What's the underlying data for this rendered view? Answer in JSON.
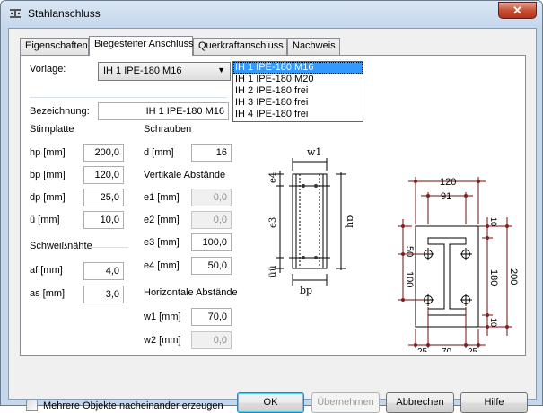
{
  "window": {
    "title": "Stahlanschluss",
    "close_label": "✕"
  },
  "tabs": [
    {
      "label": "Eigenschaften"
    },
    {
      "label": "Biegesteifer Anschluss"
    },
    {
      "label": "Querkraftanschluss"
    },
    {
      "label": "Nachweis"
    }
  ],
  "vorlage": {
    "label": "Vorlage:",
    "value": "IH 1 IPE-180 M16",
    "options": [
      "IH 1 IPE-180 M16",
      "IH 1 IPE-180 M20",
      "IH 2 IPE-180 frei",
      "IH 3 IPE-180 frei",
      "IH 4 IPE-180 frei"
    ]
  },
  "bezeichnung": {
    "label": "Bezeichnung:",
    "value": "IH 1 IPE-180 M16"
  },
  "stirnplatte": {
    "title": "Stirnplatte",
    "hp": {
      "label": "hp [mm]",
      "value": "200,0"
    },
    "bp": {
      "label": "bp [mm]",
      "value": "120,0"
    },
    "dp": {
      "label": "dp [mm]",
      "value": "25,0"
    },
    "u": {
      "label": "ü [mm]",
      "value": "10,0"
    }
  },
  "schweissnaehte": {
    "title": "Schweißnähte",
    "af": {
      "label": "af [mm]",
      "value": "4,0"
    },
    "as": {
      "label": "as [mm]",
      "value": "3,0"
    }
  },
  "schrauben": {
    "title": "Schrauben",
    "d": {
      "label": "d [mm]",
      "value": "16"
    }
  },
  "vertikale": {
    "title": "Vertikale Abstände",
    "e1": {
      "label": "e1 [mm]",
      "value": "0,0"
    },
    "e2": {
      "label": "e2 [mm]",
      "value": "0,0"
    },
    "e3": {
      "label": "e3 [mm]",
      "value": "100,0"
    },
    "e4": {
      "label": "e4 [mm]",
      "value": "50,0"
    }
  },
  "horizontale": {
    "title": "Horizontale Abstände",
    "w1": {
      "label": "w1 [mm]",
      "value": "70,0"
    },
    "w2": {
      "label": "w2 [mm]",
      "value": "0,0"
    }
  },
  "side_diagram": {
    "w1": "w1",
    "e4": "e4",
    "e3": "e3",
    "hp": "hp",
    "bp": "bp",
    "u": "ü",
    "e": "ü"
  },
  "front_diagram": {
    "top1": "120",
    "top2": "91",
    "left1": "50",
    "left2": "100",
    "right1": "180",
    "right2": "200",
    "r_top": "10",
    "r_bot": "10",
    "bot1": "25",
    "bot2": "70",
    "bot3": "25"
  },
  "footer": {
    "mehrere_label": "Mehrere Objekte nacheinander erzeugen",
    "ok": "OK",
    "uebernehmen": "Übernehmen",
    "abbrechen": "Abbrechen",
    "hilfe": "Hilfe"
  }
}
